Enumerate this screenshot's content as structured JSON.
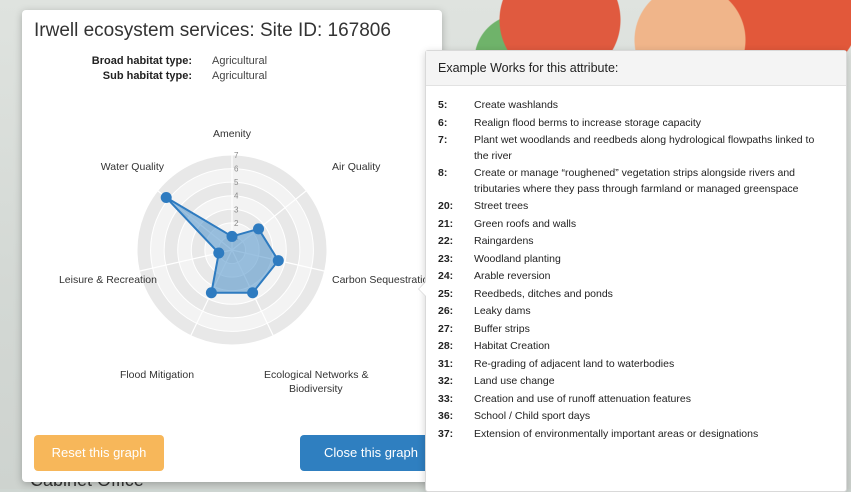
{
  "background": {
    "label": "Cabinet Office"
  },
  "popup": {
    "title": "Irwell ecosystem services: Site ID: 167806",
    "broad_habitat_label": "Broad habitat type:",
    "broad_habitat_value": "Agricultural",
    "sub_habitat_label": "Sub habitat type:",
    "sub_habitat_value": "Agricultural",
    "reset_button": "Reset this graph",
    "close_button": "Close this graph"
  },
  "radar": {
    "axes": [
      "Amenity",
      "Air Quality",
      "Carbon Sequestration",
      "Ecological Networks & Biodiversity",
      "Flood Mitigation",
      "Leisure & Recreation",
      "Water Quality"
    ],
    "ticks": [
      "1",
      "2",
      "3",
      "4",
      "5",
      "6",
      "7"
    ],
    "max": 7,
    "values": [
      1,
      2.5,
      3.5,
      3.5,
      3.5,
      1,
      6.2
    ],
    "fill_color": "#4a90c8",
    "point_color": "#2e7bc0"
  },
  "tooltip": {
    "header": "Example Works for this attribute:",
    "items": [
      {
        "num": "5:",
        "text": "Create washlands"
      },
      {
        "num": "6:",
        "text": "Realign flood berms to increase storage capacity"
      },
      {
        "num": "7:",
        "text": "Plant wet woodlands and reedbeds along hydrological flowpaths linked to the river"
      },
      {
        "num": "8:",
        "text": "Create or manage “roughened” vegetation strips alongside rivers and tributaries where they pass through farmland or managed greenspace"
      },
      {
        "num": "20:",
        "text": "Street trees"
      },
      {
        "num": "21:",
        "text": "Green roofs and walls"
      },
      {
        "num": "22:",
        "text": "Raingardens"
      },
      {
        "num": "23:",
        "text": "Woodland planting"
      },
      {
        "num": "24:",
        "text": "Arable reversion"
      },
      {
        "num": "25:",
        "text": "Reedbeds, ditches and ponds"
      },
      {
        "num": "26:",
        "text": "Leaky dams"
      },
      {
        "num": "27:",
        "text": "Buffer strips"
      },
      {
        "num": "28:",
        "text": "Habitat Creation"
      },
      {
        "num": "31:",
        "text": "Re-grading of adjacent land to waterbodies"
      },
      {
        "num": "32:",
        "text": "Land use change"
      },
      {
        "num": "33:",
        "text": "Creation and use of runoff attenuation features"
      },
      {
        "num": "36:",
        "text": "School / Child sport days"
      },
      {
        "num": "37:",
        "text": "Extension of environmentally important areas or designations"
      }
    ]
  }
}
